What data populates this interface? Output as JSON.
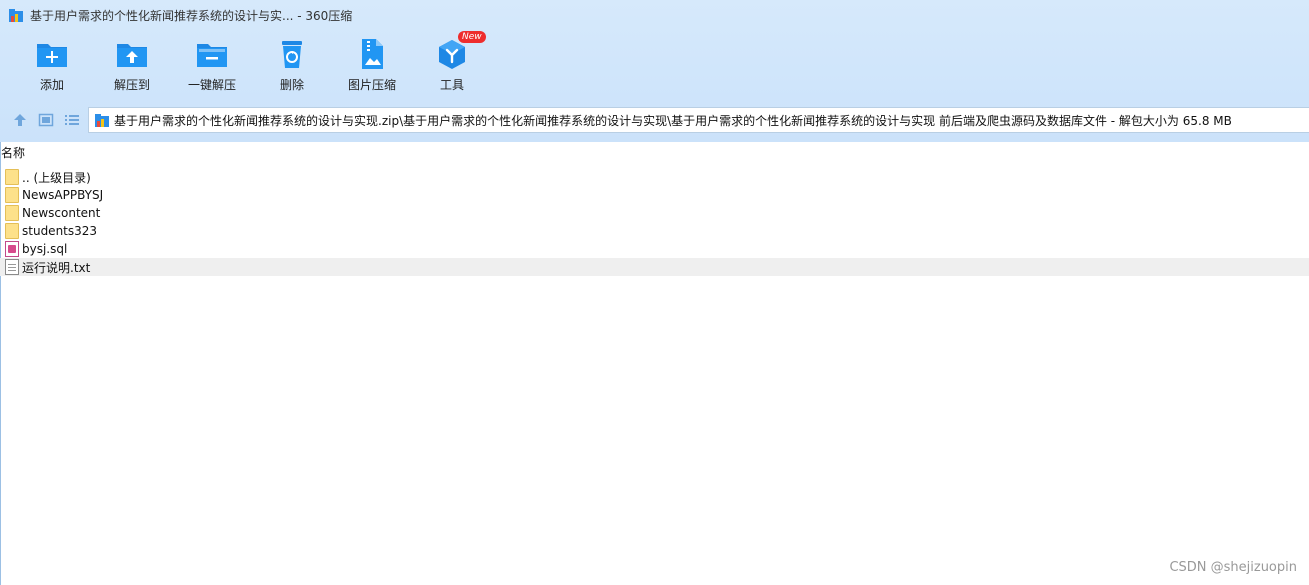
{
  "window": {
    "title": "基于用户需求的个性化新闻推荐系统的设计与实... - 360压缩"
  },
  "toolbar": {
    "items": [
      {
        "label": "添加",
        "icon": "folder-add-icon"
      },
      {
        "label": "解压到",
        "icon": "folder-extract-icon"
      },
      {
        "label": "一键解压",
        "icon": "folder-minus-icon"
      },
      {
        "label": "删除",
        "icon": "recycle-bin-icon"
      },
      {
        "label": "图片压缩",
        "icon": "image-compress-icon"
      },
      {
        "label": "工具",
        "icon": "tools-cube-icon",
        "badge": "New"
      }
    ]
  },
  "nav": {
    "path": "基于用户需求的个性化新闻推荐系统的设计与实现.zip\\基于用户需求的个性化新闻推荐系统的设计与实现\\基于用户需求的个性化新闻推荐系统的设计与实现 前后端及爬虫源码及数据库文件 - 解包大小为 65.8 MB"
  },
  "list": {
    "column_name": "名称",
    "items": [
      {
        "name": ".. (上级目录)",
        "type": "folder"
      },
      {
        "name": "NewsAPPBYSJ",
        "type": "folder"
      },
      {
        "name": "Newscontent",
        "type": "folder"
      },
      {
        "name": "students323",
        "type": "folder"
      },
      {
        "name": "bysj.sql",
        "type": "sql"
      },
      {
        "name": "运行说明.txt",
        "type": "txt",
        "selected": true
      }
    ]
  },
  "watermark": "CSDN @shejizuopin",
  "colors": {
    "accent": "#1e88e5",
    "badge": "#ee2d2d",
    "folder": "#fde18a"
  }
}
